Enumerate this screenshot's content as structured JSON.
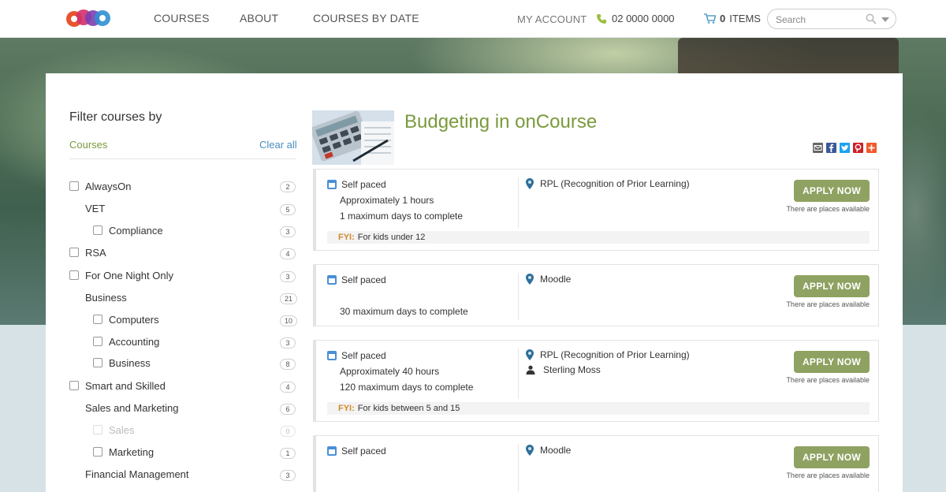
{
  "nav": {
    "links": [
      "COURSES",
      "ABOUT",
      "COURSES BY DATE"
    ],
    "my_account": "MY ACCOUNT",
    "phone": "02 0000 0000",
    "cart_count": "0",
    "cart_label": "ITEMS",
    "search_placeholder": "Search"
  },
  "filter": {
    "title": "Filter courses by",
    "courses_label": "Courses",
    "clear_all": "Clear all",
    "items": [
      {
        "label": "AlwaysOn",
        "count": "2",
        "checkbox": true
      },
      {
        "label": "VET",
        "count": "5",
        "checkbox": false
      },
      {
        "label": "Compliance",
        "count": "3",
        "checkbox": true
      },
      {
        "label": "RSA",
        "count": "4",
        "checkbox": true
      },
      {
        "label": "For One Night Only",
        "count": "3",
        "checkbox": true
      },
      {
        "label": "Business",
        "count": "21",
        "checkbox": false
      },
      {
        "label": "Computers",
        "count": "10",
        "checkbox": true
      },
      {
        "label": "Accounting",
        "count": "3",
        "checkbox": true
      },
      {
        "label": "Business",
        "count": "8",
        "checkbox": true
      },
      {
        "label": "Smart and Skilled",
        "count": "4",
        "checkbox": true
      },
      {
        "label": "Sales and Marketing",
        "count": "6",
        "checkbox": false
      },
      {
        "label": "Sales",
        "count": "0",
        "checkbox": true
      },
      {
        "label": "Marketing",
        "count": "1",
        "checkbox": true
      },
      {
        "label": "Financial Management",
        "count": "3",
        "checkbox": false
      }
    ]
  },
  "course": {
    "title": "Budgeting in onCourse",
    "share_icons": [
      "email-icon",
      "facebook-icon",
      "twitter-icon",
      "pinterest-icon",
      "more-share-icon"
    ]
  },
  "classes": [
    {
      "mode": "Self paced",
      "duration": "Approximately 1 hours",
      "days": "1 maximum days to complete",
      "location": "RPL (Recognition of Prior Learning)",
      "tutor": "",
      "fyi_label": "FYI:",
      "fyi": "For kids under 12",
      "apply": "APPLY NOW",
      "availability": "There are places available"
    },
    {
      "mode": "Self paced",
      "duration": "",
      "days": "30 maximum days to complete",
      "location": "Moodle",
      "tutor": "",
      "fyi_label": "",
      "fyi": "",
      "apply": "APPLY NOW",
      "availability": "There are places available"
    },
    {
      "mode": "Self paced",
      "duration": "Approximately 40 hours",
      "days": "120 maximum days to complete",
      "location": "RPL (Recognition of Prior Learning)",
      "tutor": "Sterling Moss",
      "fyi_label": "FYI:",
      "fyi": "For kids between 5 and 15",
      "apply": "APPLY NOW",
      "availability": "There are places available"
    },
    {
      "mode": "Self paced",
      "duration": "",
      "days": "",
      "location": "Moodle",
      "tutor": "",
      "fyi_label": "",
      "fyi": "",
      "apply": "APPLY NOW",
      "availability": "There are places available"
    }
  ],
  "colors": {
    "accent_green": "#7a9a3d",
    "button_green": "#8fa262",
    "link_blue": "#4a8fbf",
    "fyi_orange": "#d08b2a"
  }
}
